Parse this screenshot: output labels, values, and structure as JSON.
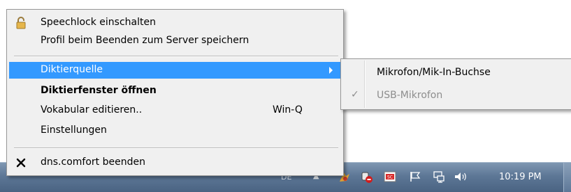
{
  "menu": {
    "items": [
      {
        "label": "Speechlock einschalten",
        "icon": "padlock-icon"
      },
      {
        "label": "Profil beim Beenden zum Server speichern"
      },
      {
        "label": "Diktierquelle",
        "highlighted": true,
        "has_submenu": true
      },
      {
        "label": "Diktierfenster öffnen",
        "bold": true
      },
      {
        "label": "Vokabular editieren..",
        "shortcut": "Win-Q"
      },
      {
        "label": "Einstellungen"
      },
      {
        "label": "dns.comfort beenden",
        "icon": "close-icon"
      }
    ]
  },
  "submenu": {
    "items": [
      {
        "label": "Mikrofon/Mik-In-Buchse"
      },
      {
        "label": "USB-Mikrofon",
        "checked": true,
        "disabled": true
      }
    ]
  },
  "taskbar": {
    "language": "DE",
    "clock": "10:19 PM",
    "tray_icons": [
      "show-hidden-icons",
      "dragon-icon",
      "speech-status-icon",
      "sc-icon",
      "action-center-flag-icon",
      "network-icon",
      "volume-icon"
    ]
  },
  "colors": {
    "highlight": "#3399ff",
    "menu_bg": "#f0f0f0",
    "taskbar": "#5d7796"
  }
}
